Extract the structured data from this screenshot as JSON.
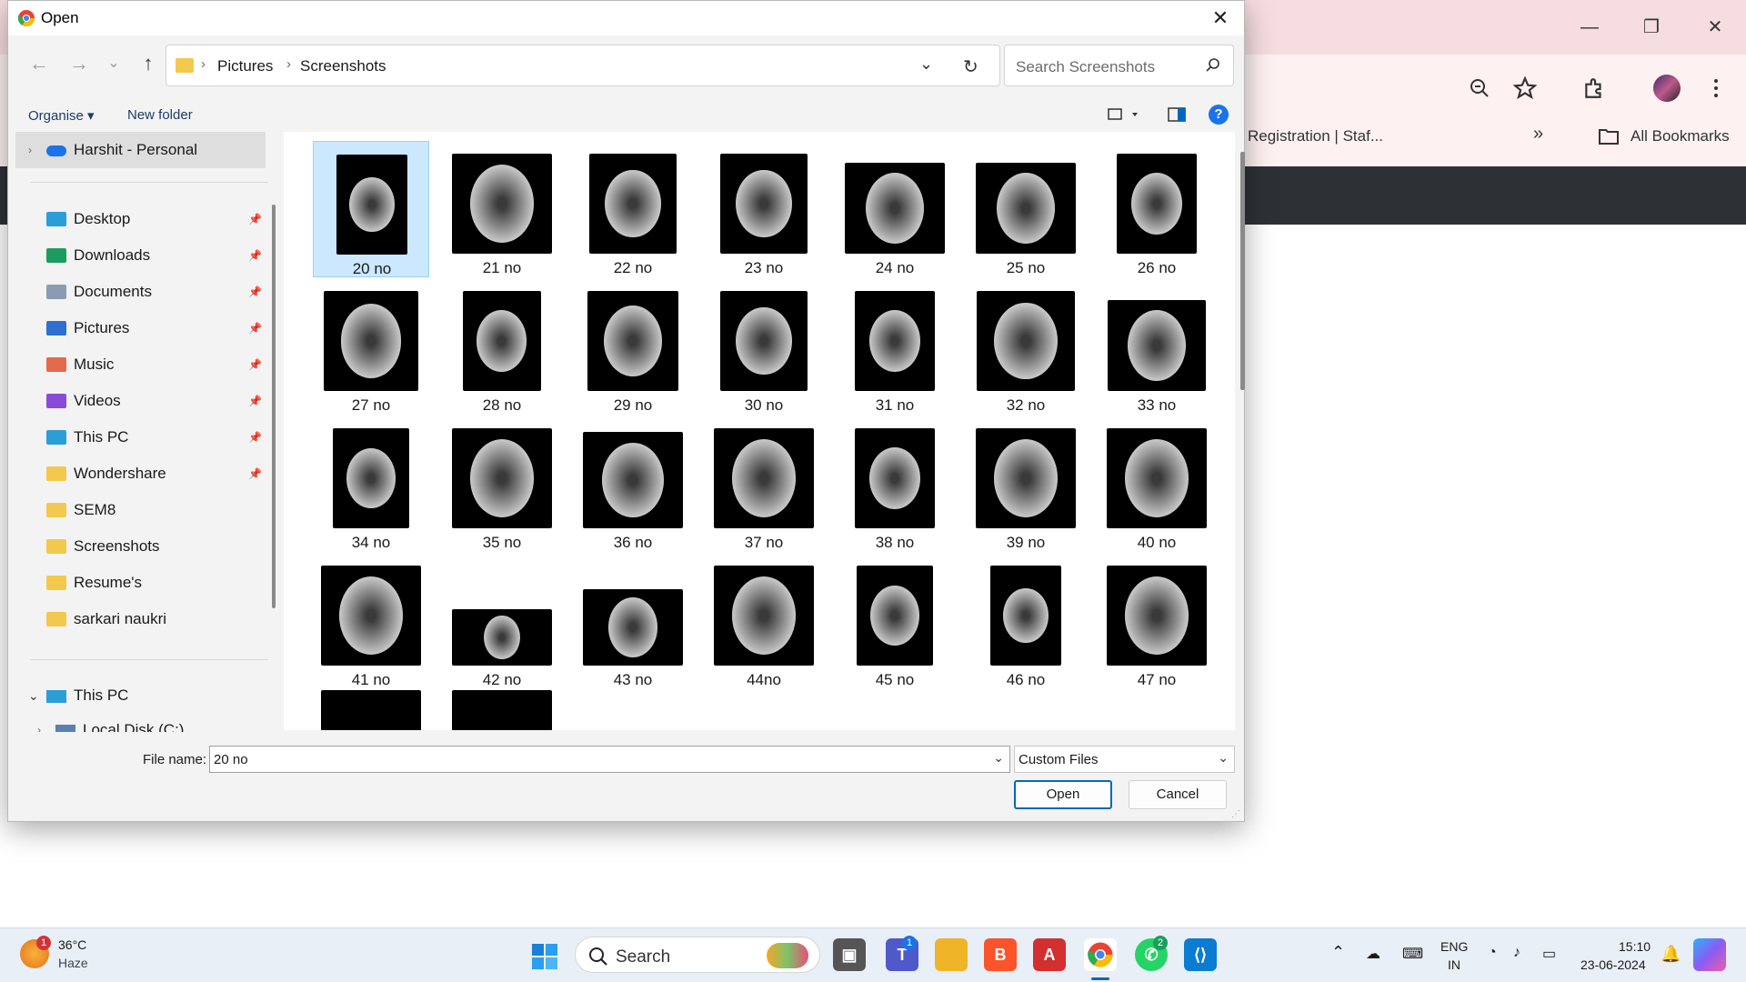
{
  "browser": {
    "bookmark_tab": "Registration | Staf...",
    "all_bookmarks": "All Bookmarks"
  },
  "dialog": {
    "title": "Open",
    "path": [
      "Pictures",
      "Screenshots"
    ],
    "search_placeholder": "Search Screenshots",
    "organise": "Organise",
    "new_folder": "New folder",
    "sidebar_top": "Harshit - Personal",
    "quick_access": [
      {
        "label": "Desktop",
        "icon": "desktop-icon"
      },
      {
        "label": "Downloads",
        "icon": "download-icon"
      },
      {
        "label": "Documents",
        "icon": "document-icon"
      },
      {
        "label": "Pictures",
        "icon": "pictures-icon"
      },
      {
        "label": "Music",
        "icon": "music-icon"
      },
      {
        "label": "Videos",
        "icon": "videos-icon"
      },
      {
        "label": "This PC",
        "icon": "computer-icon"
      },
      {
        "label": "Wondershare",
        "icon": "folder-icon"
      },
      {
        "label": "SEM8",
        "icon": "folder-icon"
      },
      {
        "label": "Screenshots",
        "icon": "folder-icon"
      },
      {
        "label": "Resume's",
        "icon": "folder-icon"
      },
      {
        "label": "sarkari naukri",
        "icon": "folder-icon"
      }
    ],
    "this_pc": "This PC",
    "local_disk": "Local Disk (C:)",
    "files": [
      "20 no",
      "21 no",
      "22 no",
      "23 no",
      "24 no",
      "25 no",
      "26 no",
      "27 no",
      "28 no",
      "29 no",
      "30 no",
      "31 no",
      "32 no",
      "33 no",
      "34 no",
      "35 no",
      "36 no",
      "37 no",
      "38 no",
      "39 no",
      "40 no",
      "41 no",
      "42 no",
      "43 no",
      "44no",
      "45 no",
      "46 no",
      "47 no"
    ],
    "selected_file": "20 no",
    "file_name_label": "File name:",
    "file_name_value": "20 no",
    "file_type": "Custom Files",
    "open_btn": "Open",
    "cancel_btn": "Cancel"
  },
  "taskbar": {
    "weather_temp": "36°C",
    "weather_desc": "Haze",
    "weather_badge": "1",
    "search_label": "Search",
    "teams_badge": "1",
    "whatsapp_badge": "2",
    "lang_top": "ENG",
    "lang_bottom": "IN",
    "time": "15:10",
    "date": "23-06-2024"
  }
}
